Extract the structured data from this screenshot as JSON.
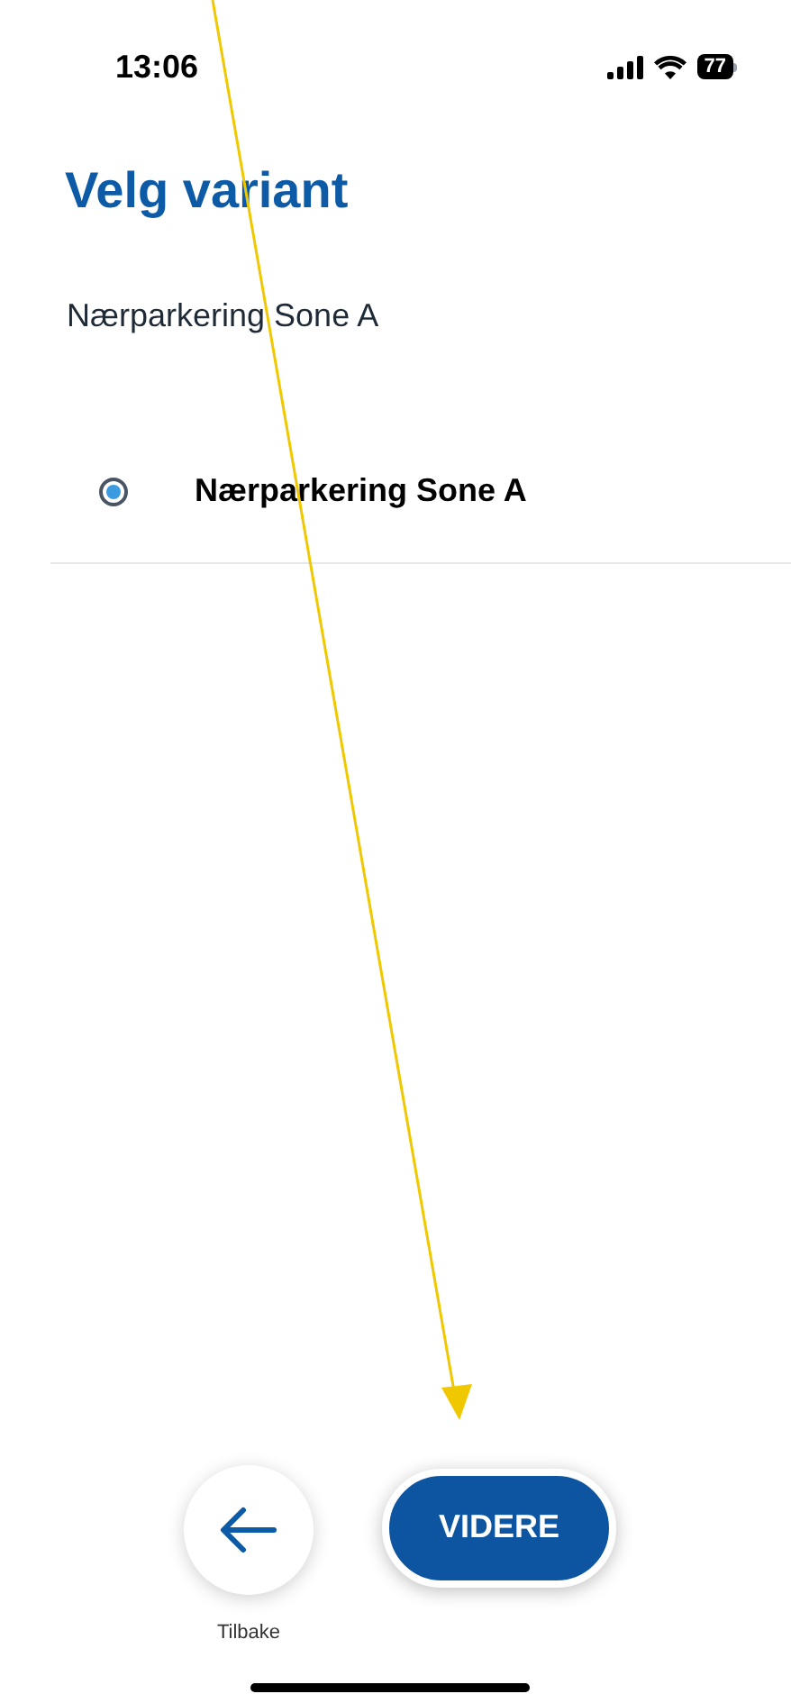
{
  "status_bar": {
    "time": "13:06",
    "battery": "77"
  },
  "title": "Velg variant",
  "variant_label": "Nærparkering Sone A",
  "options": [
    {
      "label": "Nærparkering Sone A",
      "selected": true
    }
  ],
  "back_button": {
    "label": "Tilbake"
  },
  "next_button": {
    "label": "VIDERE"
  }
}
